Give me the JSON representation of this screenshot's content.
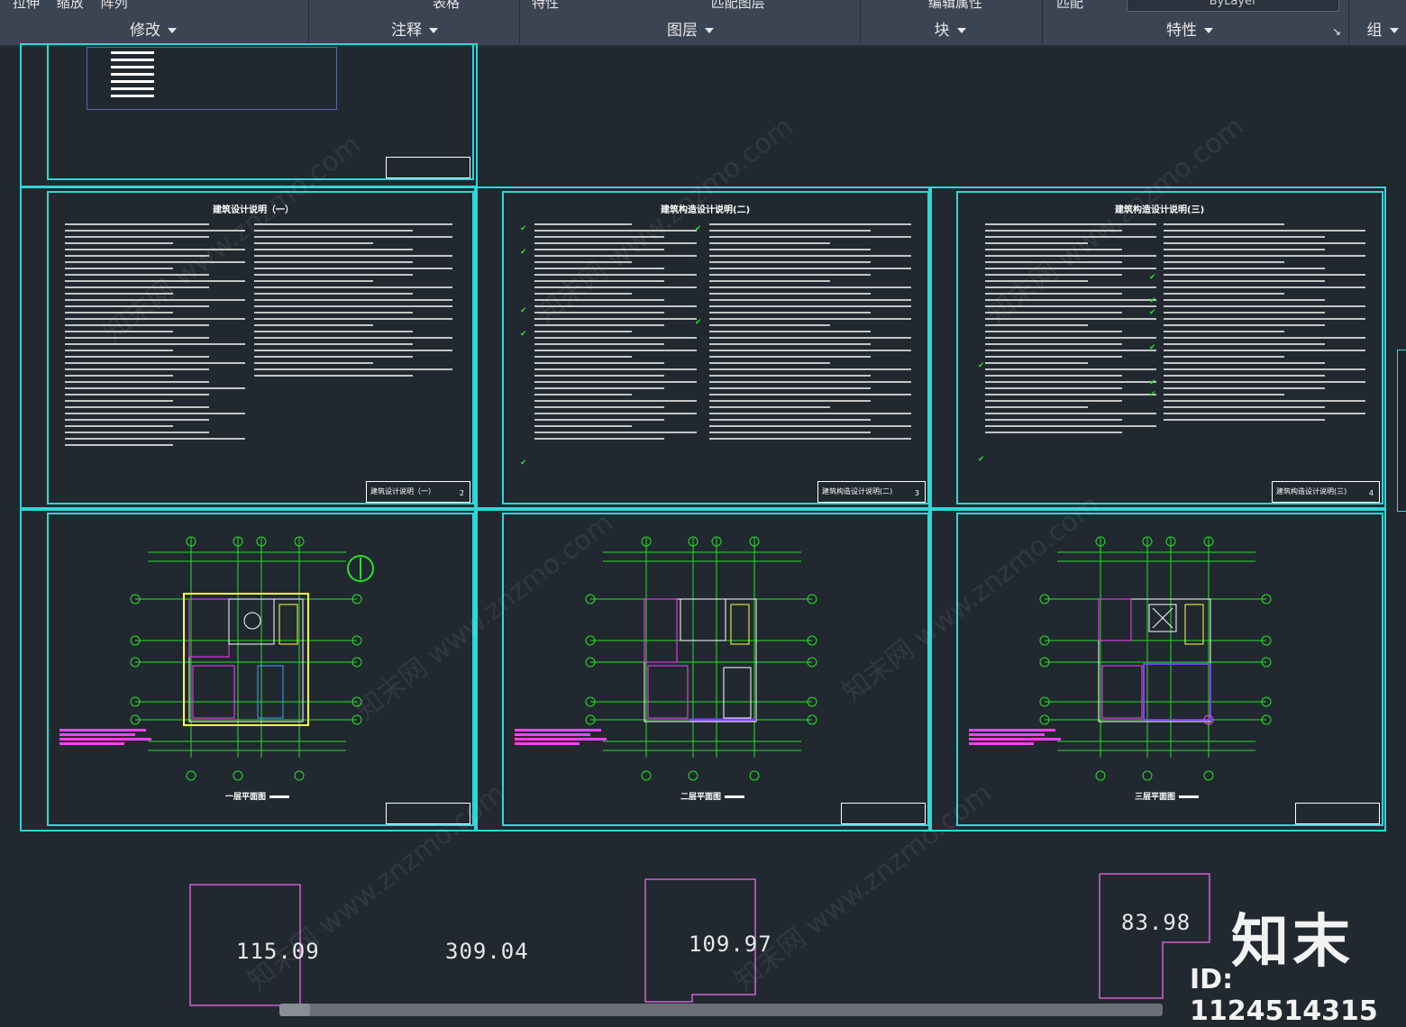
{
  "ribbon": {
    "top_partial": [
      "拉伸",
      "缩放",
      "阵列",
      "表格",
      "特性",
      "匹配图层",
      "编辑属性",
      "匹配"
    ],
    "panels": [
      {
        "label": "修改"
      },
      {
        "label": "注释"
      },
      {
        "label": "图层"
      },
      {
        "label": "块"
      },
      {
        "label": "特性"
      },
      {
        "label": "组"
      }
    ],
    "bylayer": "ByLayer"
  },
  "sheets": {
    "design_notes_1": {
      "title": "建筑设计说明（一）",
      "block_title": "建筑设计说明（一）",
      "number": "2"
    },
    "design_notes_2": {
      "title": "建筑构造设计说明(二)",
      "block_title": "建筑构造设计说明(二)",
      "number": "3"
    },
    "design_notes_3": {
      "title": "建筑构造设计说明(三)",
      "block_title": "建筑构造设计说明(三)",
      "number": "4"
    },
    "plan_1": {
      "caption": "一层平面图"
    },
    "plan_2": {
      "caption": "二层平面图"
    },
    "plan_3": {
      "caption": "三层平面图"
    }
  },
  "areas": [
    "115.09",
    "309.04",
    "109.97",
    "83.98"
  ],
  "brand": {
    "logo": "知末",
    "id": "ID: 1124514315"
  },
  "colors": {
    "frame": "#2fd6d6",
    "background": "#212830",
    "ribbon": "#3b4453",
    "grid_green": "#28e028",
    "magenta": "#ff40ff"
  }
}
